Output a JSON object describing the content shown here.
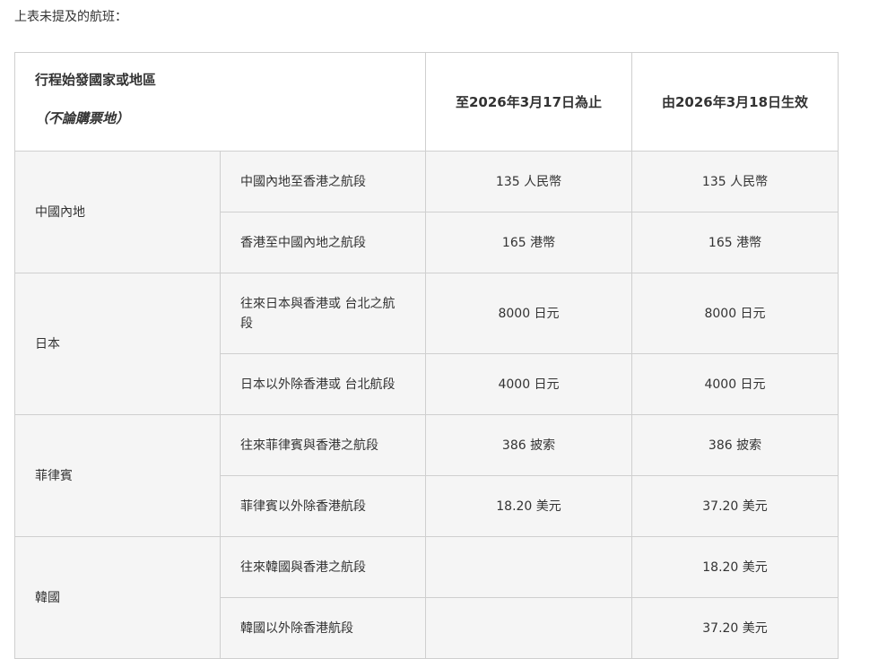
{
  "intro_text": "上表未提及的航班：",
  "table": {
    "header": {
      "region_title": "行程始發國家或地區",
      "region_subtitle": "（不論購票地）",
      "col_until": "至2026年3月17日為止",
      "col_from": "由2026年3月18日生效"
    },
    "groups": [
      {
        "country": "中國內地",
        "rows": [
          {
            "segment": "中國內地至香港之航段",
            "until": "135 人民幣",
            "from": "135 人民幣"
          },
          {
            "segment": "香港至中國內地之航段",
            "until": "165 港幣",
            "from": "165 港幣"
          }
        ]
      },
      {
        "country": "日本",
        "rows": [
          {
            "segment": "往來日本與香港或 台北之航段",
            "until": "8000 日元",
            "from": "8000 日元"
          },
          {
            "segment": "日本以外除香港或 台北航段",
            "until": "4000 日元",
            "from": "4000 日元"
          }
        ]
      },
      {
        "country": "菲律賓",
        "rows": [
          {
            "segment": "往來菲律賓與香港之航段",
            "until": "386 披索",
            "from": "386 披索"
          },
          {
            "segment": "菲律賓以外除香港航段",
            "until": "18.20 美元",
            "from": "37.20 美元"
          }
        ]
      },
      {
        "country": "韓國",
        "rows": [
          {
            "segment": "往來韓國與香港之航段",
            "until": "",
            "from": "18.20 美元"
          },
          {
            "segment": "韓國以外除香港航段",
            "until": "",
            "from": "37.20 美元"
          }
        ]
      }
    ]
  }
}
